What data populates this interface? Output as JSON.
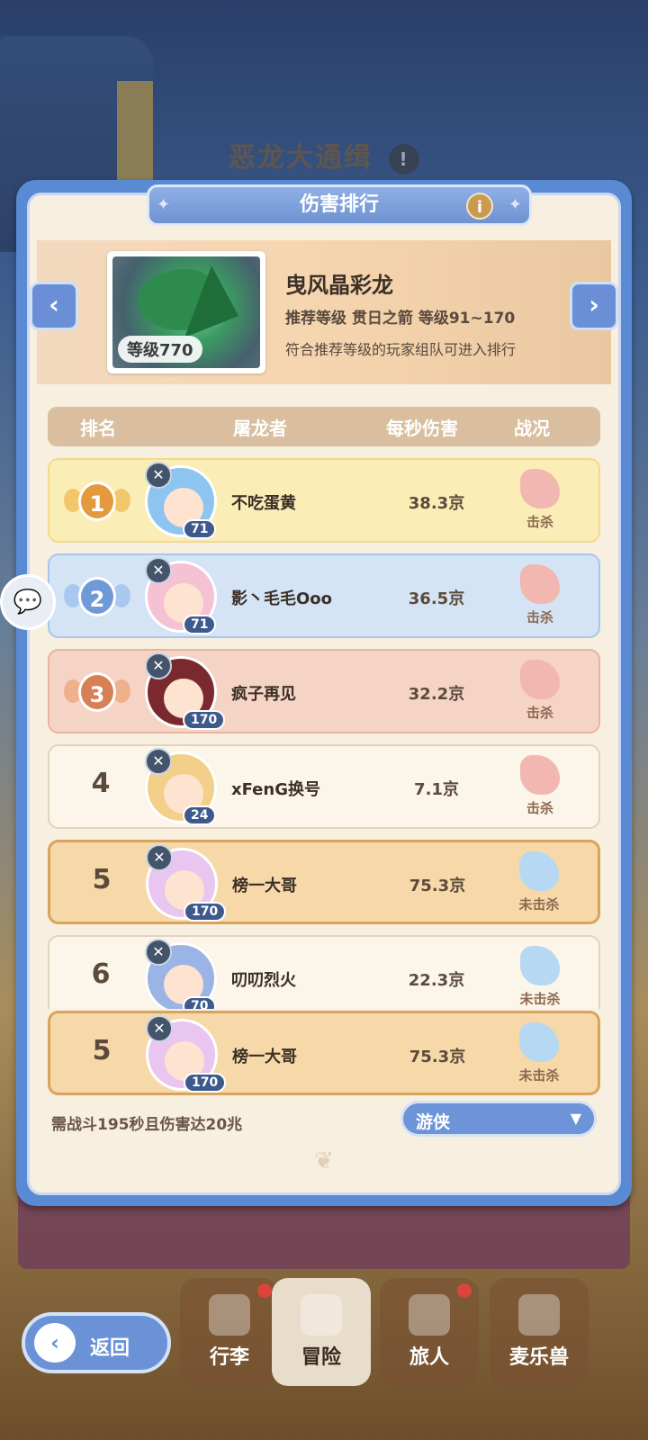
{
  "background": {
    "title": "恶龙大通缉",
    "help_icon": "help-icon"
  },
  "panel": {
    "title": "伤害排行",
    "info_icon": "i",
    "boss": {
      "name": "曳风晶彩龙",
      "level_label": "等级770",
      "recommend": "推荐等级  贯日之箭  等级91~170",
      "rule": "符合推荐等级的玩家组队可进入排行",
      "prev_icon": "‹",
      "next_icon": "›"
    },
    "columns": {
      "rank": "排名",
      "slayer": "屠龙者",
      "dps": "每秒伤害",
      "status": "战况"
    },
    "rows": [
      {
        "rank": "1",
        "level": "71",
        "name": "不吃蛋黄",
        "dps": "38.3京",
        "status": "击杀",
        "killed": true
      },
      {
        "rank": "2",
        "level": "71",
        "name": "影丶毛毛Ooo",
        "dps": "36.5京",
        "status": "击杀",
        "killed": true
      },
      {
        "rank": "3",
        "level": "170",
        "name": "疯子再见",
        "dps": "32.2京",
        "status": "击杀",
        "killed": true
      },
      {
        "rank": "4",
        "level": "24",
        "name": "xFenG换号",
        "dps": "7.1京",
        "status": "击杀",
        "killed": true
      },
      {
        "rank": "5",
        "level": "170",
        "name": "榜一大哥",
        "dps": "75.3京",
        "status": "未击杀",
        "killed": false
      },
      {
        "rank": "6",
        "level": "70",
        "name": "叨叨烈火",
        "dps": "22.3京",
        "status": "未击杀",
        "killed": false
      }
    ],
    "self_row": {
      "rank": "5",
      "level": "170",
      "name": "榜一大哥",
      "dps": "75.3京",
      "status": "未击杀"
    },
    "requirement": "需战斗195秒且伤害达20兆",
    "class_filter": {
      "value": "游侠",
      "caret": "▼"
    }
  },
  "bottom_nav": {
    "back": {
      "label": "返回",
      "icon": "‹"
    },
    "items": [
      {
        "label": "行李",
        "badge": true
      },
      {
        "label": "冒险",
        "badge": false
      },
      {
        "label": "旅人",
        "badge": true
      },
      {
        "label": "麦乐兽",
        "badge": false
      }
    ]
  },
  "colors": {
    "panel_blue": "#5a8ad4",
    "gold": "#e5a545",
    "silver_blue": "#6f9ad8",
    "bronze": "#d77f55",
    "kill_red": "#f1b7b0",
    "alive_blue": "#b7d8f2"
  }
}
